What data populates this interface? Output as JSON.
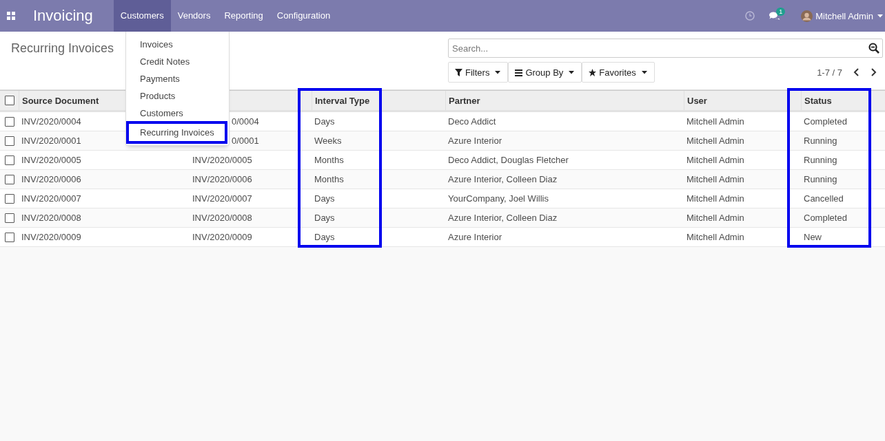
{
  "navbar": {
    "app_title": "Invoicing",
    "menus": [
      {
        "label": "Customers",
        "selected": true
      },
      {
        "label": "Vendors",
        "selected": false
      },
      {
        "label": "Reporting",
        "selected": false
      },
      {
        "label": "Configuration",
        "selected": false
      }
    ],
    "messages_badge": "1",
    "user": "Mitchell Admin"
  },
  "dropdown": {
    "items": [
      {
        "label": "Invoices",
        "highlighted": false
      },
      {
        "label": "Credit Notes",
        "highlighted": false
      },
      {
        "label": "Payments",
        "highlighted": false
      },
      {
        "label": "Products",
        "highlighted": false
      },
      {
        "label": "Customers",
        "highlighted": false
      },
      {
        "label": "Recurring Invoices",
        "highlighted": true
      }
    ]
  },
  "page_title": "Recurring Invoices",
  "search": {
    "placeholder": "Search..."
  },
  "filters": [
    {
      "kind": "filter",
      "label": "Filters"
    },
    {
      "kind": "group",
      "label": "Group By"
    },
    {
      "kind": "star",
      "label": "Favorites"
    }
  ],
  "pager": "1-7 / 7",
  "table": {
    "all_selected": false,
    "columns": [
      {
        "label": "Source Document",
        "highlighted": false
      },
      null,
      {
        "label": "Interval Type",
        "highlighted": true
      },
      {
        "label": "Partner",
        "highlighted": false
      },
      {
        "label": "User",
        "highlighted": false
      },
      {
        "label": "Status",
        "highlighted": true
      }
    ],
    "rows": [
      {
        "checked": false,
        "cells": [
          "INV/2020/0004",
          "0/0004",
          "Days",
          "Deco Addict",
          "Mitchell Admin",
          "Completed"
        ]
      },
      {
        "checked": false,
        "cells": [
          "INV/2020/0001",
          "0/0001",
          "Weeks",
          "Azure Interior",
          "Mitchell Admin",
          "Running"
        ]
      },
      {
        "checked": false,
        "cells": [
          "INV/2020/0005",
          "INV/2020/0005",
          "Months",
          "Deco Addict, Douglas Fletcher",
          "Mitchell Admin",
          "Running"
        ]
      },
      {
        "checked": false,
        "cells": [
          "INV/2020/0006",
          "INV/2020/0006",
          "Months",
          "Azure Interior, Colleen Diaz",
          "Mitchell Admin",
          "Running"
        ]
      },
      {
        "checked": false,
        "cells": [
          "INV/2020/0007",
          "INV/2020/0007",
          "Days",
          "YourCompany, Joel Willis",
          "Mitchell Admin",
          "Cancelled"
        ]
      },
      {
        "checked": false,
        "cells": [
          "INV/2020/0008",
          "INV/2020/0008",
          "Days",
          "Azure Interior, Colleen Diaz",
          "Mitchell Admin",
          "Completed"
        ]
      },
      {
        "checked": false,
        "cells": [
          "INV/2020/0009",
          "INV/2020/0009",
          "Days",
          "Azure Interior",
          "Mitchell Admin",
          "New"
        ]
      }
    ]
  }
}
